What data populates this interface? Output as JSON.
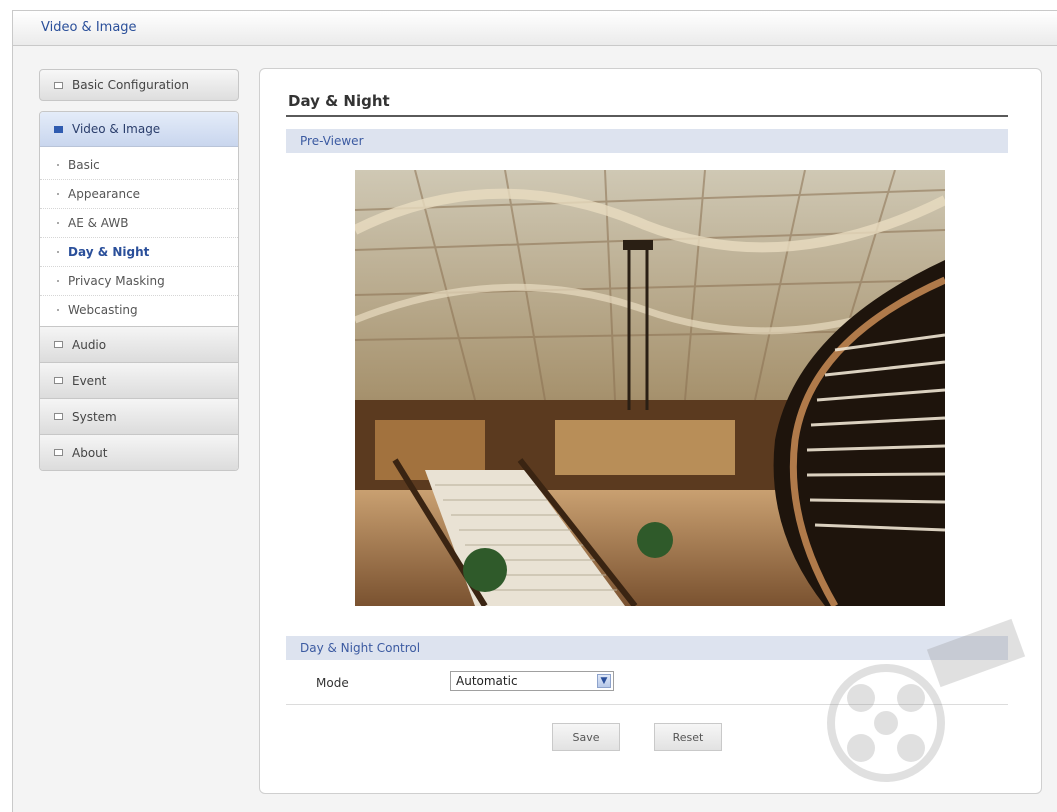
{
  "header": {
    "title": "Video & Image"
  },
  "sidebar": {
    "basic_configuration": "Basic Configuration",
    "video_image": {
      "label": "Video & Image",
      "items": [
        {
          "label": "Basic"
        },
        {
          "label": "Appearance"
        },
        {
          "label": "AE & AWB"
        },
        {
          "label": "Day & Night",
          "active": true
        },
        {
          "label": "Privacy Masking"
        },
        {
          "label": "Webcasting"
        }
      ]
    },
    "groups": [
      {
        "label": "Audio"
      },
      {
        "label": "Event"
      },
      {
        "label": "System"
      },
      {
        "label": "About"
      }
    ]
  },
  "main": {
    "title": "Day & Night",
    "preview_section": "Pre-Viewer",
    "control_section": "Day & Night Control",
    "mode": {
      "label": "Mode",
      "value": "Automatic"
    },
    "buttons": {
      "save": "Save",
      "reset": "Reset"
    }
  },
  "colors": {
    "accent": "#2a4f9a",
    "section_bar": "#dde3ef"
  }
}
